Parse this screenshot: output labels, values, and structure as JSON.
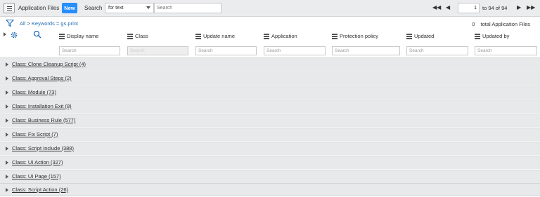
{
  "header": {
    "title": "Application Files",
    "new_label": "New",
    "search_label": "Search",
    "search_field_selected": "for text",
    "search_placeholder": "Search"
  },
  "pager": {
    "current_page": "1",
    "range_text": "to 94 of 94"
  },
  "breadcrumb": {
    "all": "All",
    "separator": ">",
    "filter": "Keywords = gs.print"
  },
  "total": {
    "count": "0",
    "label": "total Application Files"
  },
  "columns": [
    {
      "label": "Display name",
      "search_placeholder": "Search"
    },
    {
      "label": "Class",
      "search_placeholder": "Search"
    },
    {
      "label": "Update name",
      "search_placeholder": "Search"
    },
    {
      "label": "Application",
      "search_placeholder": "Search"
    },
    {
      "label": "Protection policy",
      "search_placeholder": "Search"
    },
    {
      "label": "Updated",
      "search_placeholder": "Search"
    },
    {
      "label": "Updated by",
      "search_placeholder": "Search"
    }
  ],
  "groups": [
    "Class: Clone Cleanup Script (4)",
    "Class: Approval Steps (2)",
    "Class: Module (73)",
    "Class: Installation Exit (8)",
    "Class: Business Rule (577)",
    "Class: Fix Script (7)",
    "Class: Script Include (388)",
    "Class: UI Action (327)",
    "Class: UI Page (157)",
    "Class: Script Action (26)"
  ],
  "icons": {
    "menu": "hamburger-icon",
    "filter": "funnel-icon",
    "settings": "gear-icon",
    "search": "search-icon",
    "pager": [
      "first-page-icon",
      "prev-page-icon",
      "next-page-icon",
      "last-page-icon"
    ]
  },
  "colors": {
    "accent": "#278efc",
    "link": "#1f6bb5",
    "group_bg": "#e8e9eb",
    "toolbar_bg": "#ebecee"
  }
}
